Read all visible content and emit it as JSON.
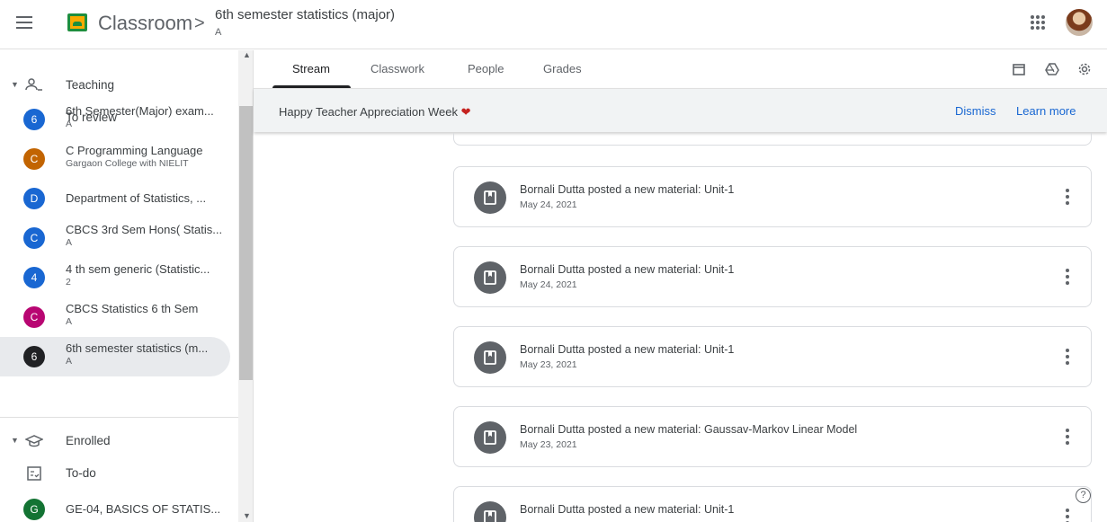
{
  "header": {
    "app_name": "Classroom",
    "separator": ">",
    "class_title": "6th semester statistics (major)",
    "class_section": "A",
    "apps_icon": "apps-grid-icon",
    "avatar": "user-avatar"
  },
  "sidebar": {
    "teaching_label": "Teaching",
    "to_review_label": "To review",
    "enrolled_label": "Enrolled",
    "todo_label": "To-do",
    "classes": [
      {
        "initial": "6",
        "title": "6th Semester(Major) exam...",
        "sub": "A",
        "color": "#1967d2"
      },
      {
        "initial": "C",
        "title": "C Programming Language",
        "sub": "Gargaon College with NIELIT",
        "color": "#c26401"
      },
      {
        "initial": "D",
        "title": "Department of Statistics, ...",
        "sub": "",
        "color": "#1967d2"
      },
      {
        "initial": "C",
        "title": "CBCS 3rd Sem Hons( Statis...",
        "sub": "A",
        "color": "#1967d2"
      },
      {
        "initial": "4",
        "title": "4 th sem generic (Statistic...",
        "sub": "2",
        "color": "#1967d2"
      },
      {
        "initial": "C",
        "title": "CBCS Statistics 6 th Sem",
        "sub": "A",
        "color": "#b80672"
      },
      {
        "initial": "6",
        "title": "6th semester statistics (m...",
        "sub": "A",
        "color": "#202124"
      }
    ],
    "enrolled_classes": [
      {
        "initial": "G",
        "title": "GE-04, BASICS OF STATIS...",
        "color": "#137333"
      }
    ]
  },
  "tabs": [
    "Stream",
    "Classwork",
    "People",
    "Grades"
  ],
  "banner": {
    "text": "Happy Teacher Appreciation Week",
    "heart": "❤",
    "dismiss": "Dismiss",
    "learn_more": "Learn more"
  },
  "posts": [
    {
      "title": "Bornali Dutta posted a new material: Unit-1",
      "date": "May 24, 2021"
    },
    {
      "title": "Bornali Dutta posted a new material: Unit-1",
      "date": "May 24, 2021"
    },
    {
      "title": "Bornali Dutta posted a new material: Unit-1",
      "date": "May 23, 2021"
    },
    {
      "title": "Bornali Dutta posted a new material: Gaussav-Markov Linear Model",
      "date": "May 23, 2021"
    },
    {
      "title": "Bornali Dutta posted a new material: Unit-1",
      "date": ""
    }
  ],
  "help": "?"
}
